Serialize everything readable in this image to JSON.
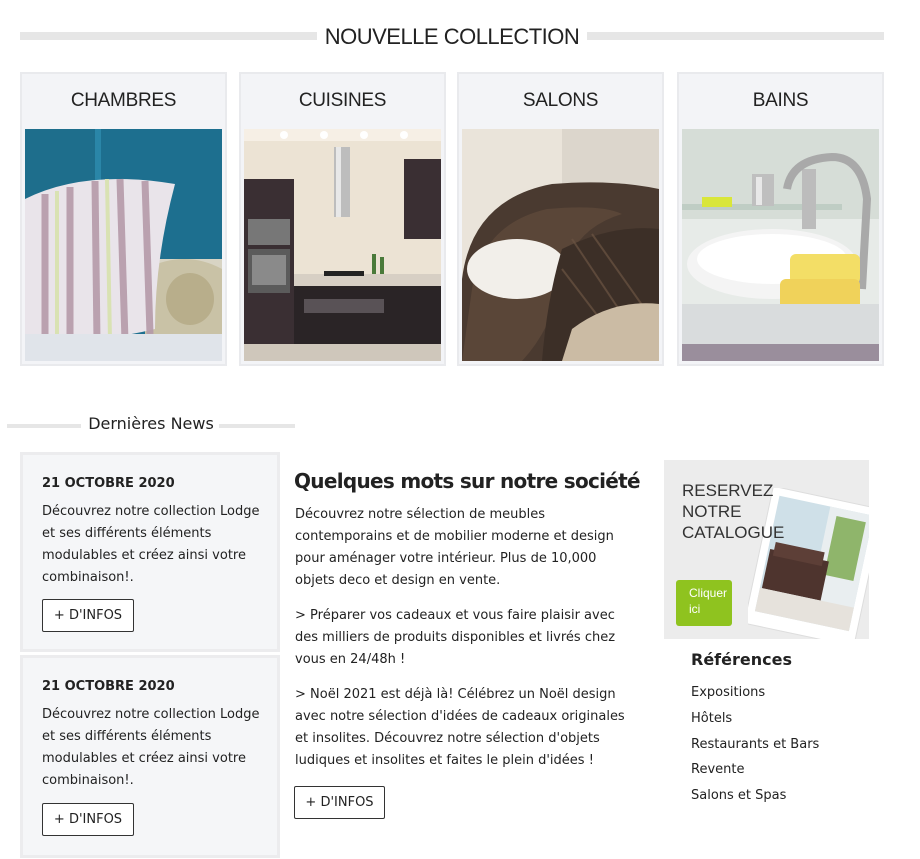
{
  "header": {
    "title": "NOUVELLE COLLECTION"
  },
  "categories": [
    {
      "label": "CHAMBRES"
    },
    {
      "label": "CUISINES"
    },
    {
      "label": "SALONS"
    },
    {
      "label": "BAINS"
    }
  ],
  "news": {
    "title": "Dernières News",
    "items": [
      {
        "date": "21 OCTOBRE 2020",
        "text": "Découvrez notre collection Lodge et ses différents éléments modulables et créez ainsi votre combinaison!.",
        "button": "+ D'INFOS"
      },
      {
        "date": "21 OCTOBRE 2020",
        "text": "Découvrez notre collection Lodge et ses différents éléments modulables et créez ainsi votre combinaison!.",
        "button": "+ D'INFOS"
      }
    ]
  },
  "about": {
    "title": "Quelques mots sur notre société",
    "paragraphs": [
      "Découvrez notre sélection de meubles contemporains et de mobilier moderne et design pour aménager votre intérieur. Plus de 10,000 objets deco et design en vente.",
      "> Préparer vos cadeaux et vous faire plaisir avec des milliers de produits disponibles et livrés chez vous en 24/48h !",
      "> Noël 2021 est déjà là! Célébrez un Noël design avec notre sélection d'idées de cadeaux originales et insolites. Découvrez notre sélection d'objets ludiques et insolites et faites le plein d'idées !"
    ],
    "button": "+ D'INFOS"
  },
  "catalogue": {
    "lines": [
      "RESERVEZ",
      "NOTRE",
      "CATALOGUE"
    ],
    "cta_line1": "Cliquer",
    "cta_line2": "ici",
    "accent_color": "#8fc31f"
  },
  "references": {
    "title": "Références",
    "items": [
      "Expositions",
      "Hôtels",
      "Restaurants et Bars",
      "Revente",
      "Salons et Spas"
    ]
  }
}
